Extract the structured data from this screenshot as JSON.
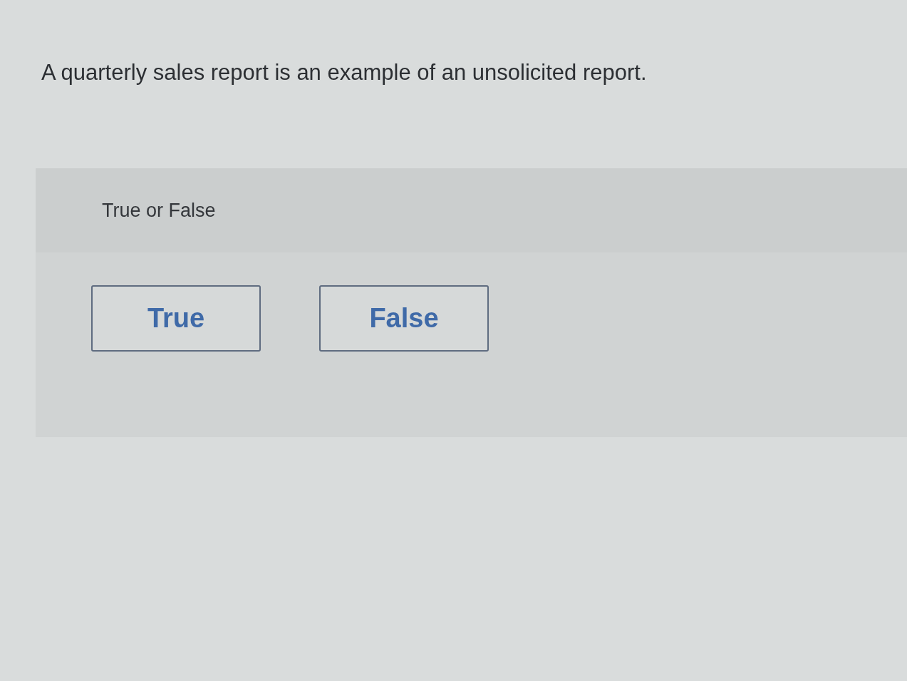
{
  "question": {
    "text": "A quarterly sales report is an example of an unsolicited report."
  },
  "answer_panel": {
    "prompt": "True or False",
    "options": [
      {
        "label": "True",
        "selected": false
      },
      {
        "label": "False",
        "selected": false
      }
    ]
  }
}
